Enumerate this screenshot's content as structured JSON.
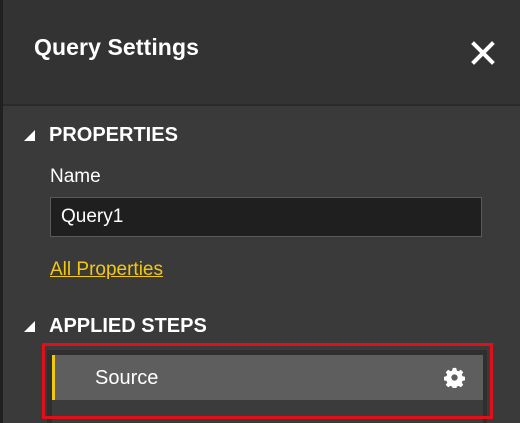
{
  "panel": {
    "title": "Query Settings",
    "close_icon": "close-icon"
  },
  "properties": {
    "section_label": "PROPERTIES",
    "name_label": "Name",
    "name_value": "Query1",
    "all_properties_link": "All Properties"
  },
  "applied_steps": {
    "section_label": "APPLIED STEPS",
    "steps": [
      {
        "label": "Source",
        "icon": "gear-icon",
        "selected": true
      }
    ]
  },
  "colors": {
    "accent": "#f2c811",
    "highlight": "#e0101a",
    "panel_bg": "#3a3a3a",
    "header_bg": "#333333",
    "selected_row": "#5e5e5e"
  }
}
